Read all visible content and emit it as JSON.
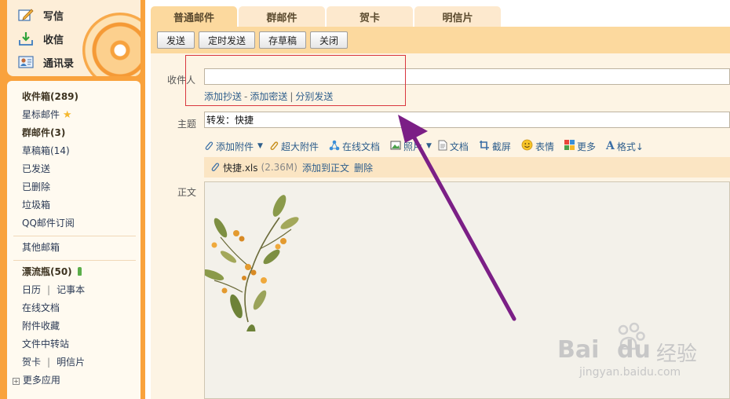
{
  "sidebar": {
    "quick_actions": [
      {
        "label": "写信",
        "icon": "compose-icon"
      },
      {
        "label": "收信",
        "icon": "inbox-download-icon"
      },
      {
        "label": "通讯录",
        "icon": "contacts-icon"
      }
    ],
    "folders": {
      "inbox": "收件箱(289)",
      "starred": "星标邮件",
      "group": "群邮件(3)",
      "drafts": "草稿箱(14)",
      "sent": "已发送",
      "deleted": "已删除",
      "spam": "垃圾箱",
      "subscriptions": "QQ邮件订阅",
      "other": "其他邮箱",
      "drift_bottle": "漂流瓶(50)",
      "calendar": "日历",
      "notebook": "记事本",
      "online_docs": "在线文档",
      "attachments": "附件收藏",
      "file_transfer": "文件中转站",
      "greeting_card": "贺卡",
      "postcard": "明信片",
      "more_apps": "更多应用"
    },
    "separator": "|"
  },
  "tabs": [
    {
      "label": "普通邮件",
      "active": true
    },
    {
      "label": "群邮件",
      "active": false
    },
    {
      "label": "贺卡",
      "active": false
    },
    {
      "label": "明信片",
      "active": false
    }
  ],
  "toolbar": {
    "send": "发送",
    "scheduled_send": "定时发送",
    "save_draft": "存草稿",
    "close": "关闭"
  },
  "compose": {
    "recipient_label": "收件人",
    "recipient_value": "",
    "cc_link": "添加抄送",
    "bcc_link": "添加密送",
    "separate_send_link": "分别发送",
    "dash": "-",
    "bar": "|",
    "subject_label": "主题",
    "subject_value": "转发：快捷",
    "body_label": "正文"
  },
  "attach_bar": {
    "add_attachment": "添加附件",
    "large_attachment": "超大附件",
    "online_doc": "在线文档",
    "photo": "照片",
    "document": "文档",
    "screenshot": "截屏",
    "emoji": "表情",
    "more": "更多",
    "format": "格式↓"
  },
  "attachment": {
    "filename": "快捷.xls",
    "size": "(2.36M)",
    "add_to_body": "添加到正文",
    "delete": "删除"
  },
  "watermark": {
    "brand": "Bai",
    "brand2": "du",
    "jingyan": "经验",
    "url": "jingyan.baidu.com"
  },
  "colors": {
    "sidebar_orange": "#f9a23d",
    "toolbar": "#fcd99e",
    "compose_bg": "#fdf4e4",
    "link_blue": "#2e5e8c",
    "highlight_red": "#d9363e",
    "arrow_purple": "#7b1f86"
  }
}
